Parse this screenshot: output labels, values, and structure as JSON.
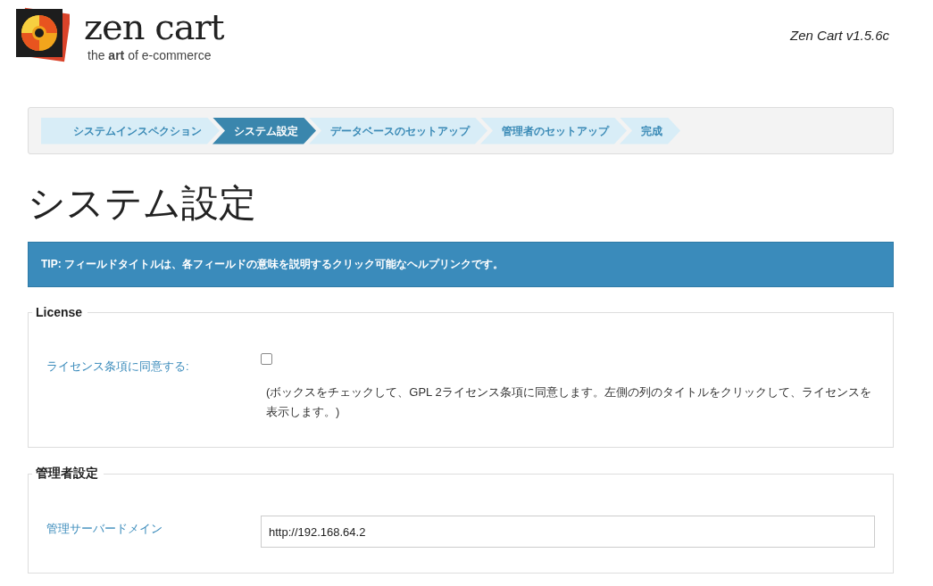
{
  "header": {
    "logo_name": "zen cart",
    "logo_tagline": "the **art** of e-commerce",
    "version": "Zen Cart v1.5.6c"
  },
  "steps": [
    {
      "label": "システムインスペクション",
      "selected": false
    },
    {
      "label": "システム設定",
      "selected": true
    },
    {
      "label": "データベースのセットアップ",
      "selected": false
    },
    {
      "label": "管理者のセットアップ",
      "selected": false
    },
    {
      "label": "完成",
      "selected": false
    }
  ],
  "page_title": "システム設定",
  "tip": "TIP: フィールドタイトルは、各フィールドの意味を説明するクリック可能なヘルプリンクです。",
  "sections": [
    {
      "legend": "License",
      "fields": [
        {
          "kind": "checkbox",
          "label": "ライセンス条項に同意する:",
          "checked": false,
          "help": "(ボックスをチェックして、GPL 2ライセンス条項に同意します。左側の列のタイトルをクリックして、ライセンスを表示します。)"
        }
      ]
    },
    {
      "legend": "管理者設定",
      "fields": [
        {
          "kind": "text",
          "label": "管理サーバードメイン",
          "value": "http://192.168.64.2"
        }
      ]
    }
  ]
}
